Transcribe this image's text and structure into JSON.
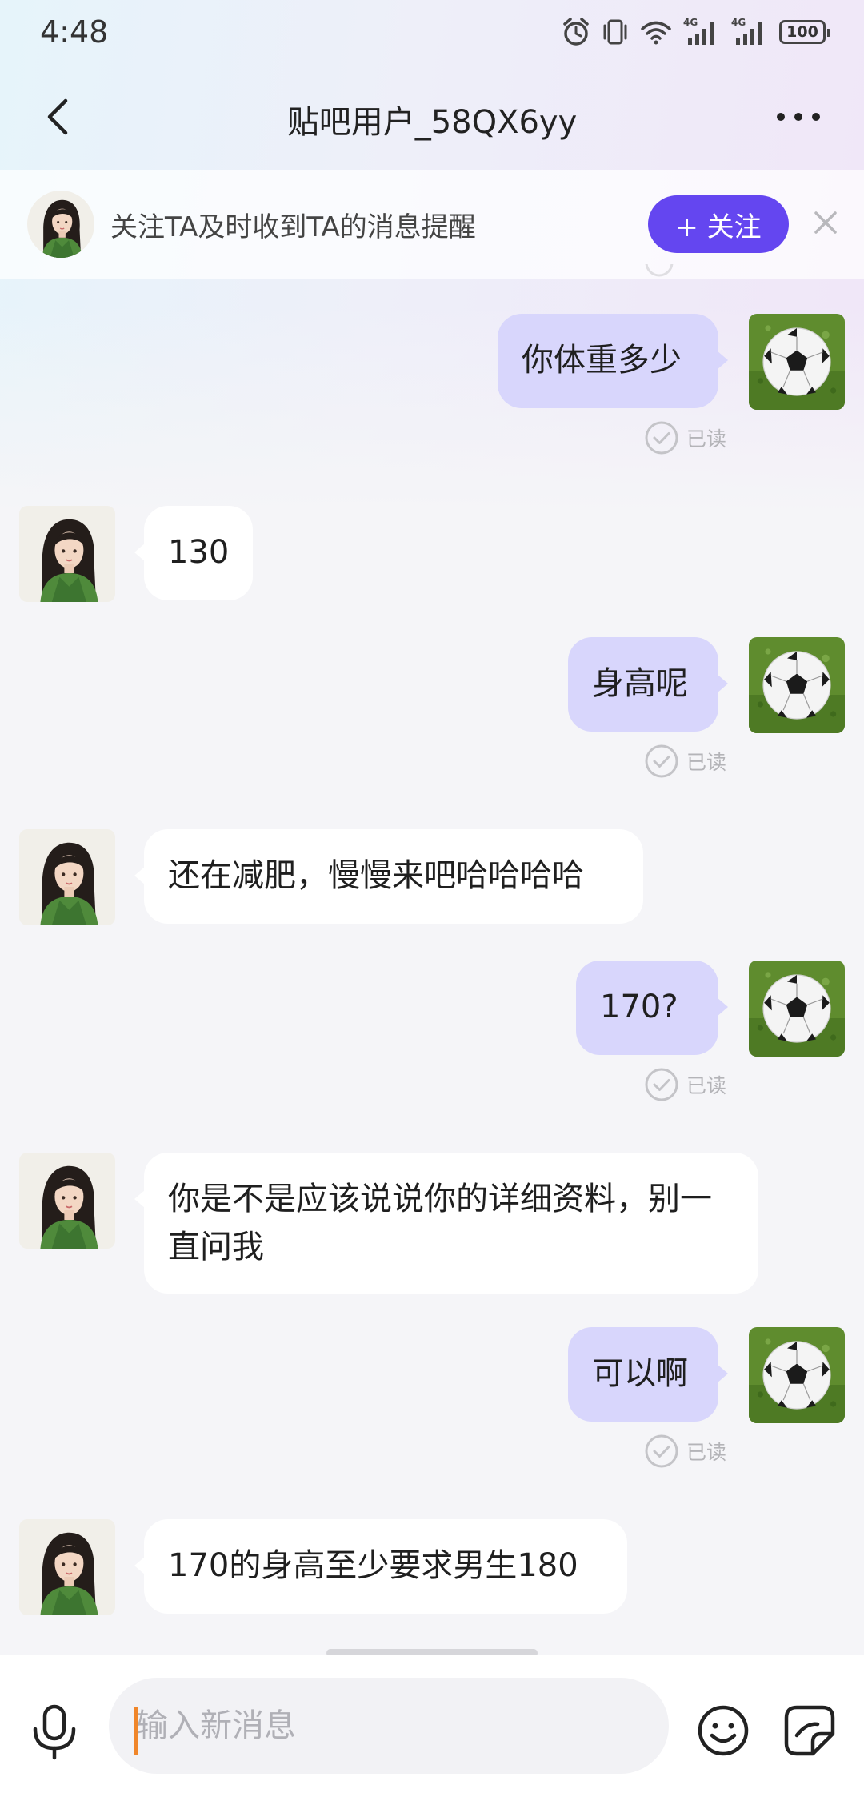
{
  "status_bar": {
    "time": "4:48",
    "battery": "100",
    "signal_label_1": "4G",
    "signal_label_2": "4G"
  },
  "header": {
    "title": "贴吧用户_58QX6yy"
  },
  "follow_banner": {
    "text": "关注TA及时收到TA的消息提醒",
    "button_label": "+ 关注"
  },
  "read_label": "已读",
  "messages": [
    {
      "side": "right",
      "text": "你体重多少",
      "status": "已读"
    },
    {
      "side": "left",
      "text": "130"
    },
    {
      "side": "right",
      "text": "身高呢",
      "status": "已读"
    },
    {
      "side": "left",
      "text": "还在减肥，慢慢来吧哈哈哈哈"
    },
    {
      "side": "right",
      "text": "170?",
      "status": "已读"
    },
    {
      "side": "left",
      "text": "你是不是应该说说你的详细资料，别一直问我"
    },
    {
      "side": "right",
      "text": "可以啊",
      "status": "已读"
    },
    {
      "side": "left",
      "text": "170的身高至少要求男生180"
    }
  ],
  "input": {
    "placeholder": "输入新消息",
    "value": ""
  },
  "colors": {
    "accent": "#6446f0",
    "my_bubble": "#d8d6fc",
    "their_bubble": "#ffffff",
    "background": "#f5f5f8",
    "caret": "#f0862a"
  },
  "icons": {
    "back": "chevron-left-icon",
    "more": "more-dots-icon",
    "close": "close-icon",
    "mic": "microphone-icon",
    "emoji": "smiley-icon",
    "sticker": "sticker-icon",
    "read": "check-circle-icon",
    "alarm": "alarm-icon",
    "vibrate": "vibrate-icon",
    "wifi": "wifi-icon",
    "signal": "signal-icon",
    "battery": "battery-icon"
  }
}
